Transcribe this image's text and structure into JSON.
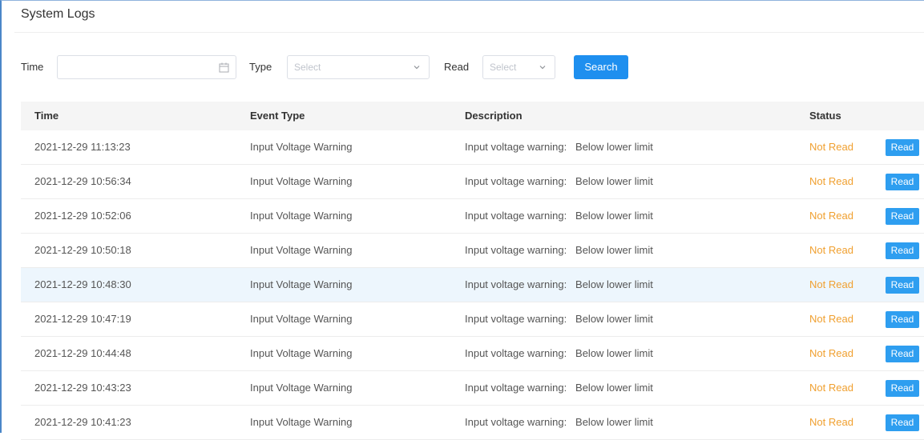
{
  "page": {
    "title": "System Logs"
  },
  "filters": {
    "time_label": "Time",
    "time_value": "",
    "type_label": "Type",
    "type_placeholder": "Select",
    "read_label": "Read",
    "read_placeholder": "Select",
    "search_label": "Search"
  },
  "table": {
    "headers": {
      "time": "Time",
      "event_type": "Event Type",
      "description": "Description",
      "status": "Status"
    },
    "rows": [
      {
        "time": "2021-12-29 11:13:23",
        "event_type": "Input Voltage Warning",
        "description": "Input voltage warning:   Below lower limit",
        "status": "Not Read",
        "action": "Read"
      },
      {
        "time": "2021-12-29 10:56:34",
        "event_type": "Input Voltage Warning",
        "description": "Input voltage warning:   Below lower limit",
        "status": "Not Read",
        "action": "Read"
      },
      {
        "time": "2021-12-29 10:52:06",
        "event_type": "Input Voltage Warning",
        "description": "Input voltage warning:   Below lower limit",
        "status": "Not Read",
        "action": "Read"
      },
      {
        "time": "2021-12-29 10:50:18",
        "event_type": "Input Voltage Warning",
        "description": "Input voltage warning:   Below lower limit",
        "status": "Not Read",
        "action": "Read"
      },
      {
        "time": "2021-12-29 10:48:30",
        "event_type": "Input Voltage Warning",
        "description": "Input voltage warning:   Below lower limit",
        "status": "Not Read",
        "action": "Read"
      },
      {
        "time": "2021-12-29 10:47:19",
        "event_type": "Input Voltage Warning",
        "description": "Input voltage warning:   Below lower limit",
        "status": "Not Read",
        "action": "Read"
      },
      {
        "time": "2021-12-29 10:44:48",
        "event_type": "Input Voltage Warning",
        "description": "Input voltage warning:   Below lower limit",
        "status": "Not Read",
        "action": "Read"
      },
      {
        "time": "2021-12-29 10:43:23",
        "event_type": "Input Voltage Warning",
        "description": "Input voltage warning:   Below lower limit",
        "status": "Not Read",
        "action": "Read"
      },
      {
        "time": "2021-12-29 10:41:23",
        "event_type": "Input Voltage Warning",
        "description": "Input voltage warning:   Below lower limit",
        "status": "Not Read",
        "action": "Read"
      }
    ],
    "highlighted_row": 4
  },
  "colors": {
    "accent": "#1e8fef",
    "read_button": "#2e9ef0",
    "status_not_read": "#f0a030",
    "row_highlight": "#edf6fd"
  },
  "icons": {
    "time_input": "calendar-icon",
    "type_select": "chevron-down-icon",
    "read_select": "chevron-down-icon"
  }
}
